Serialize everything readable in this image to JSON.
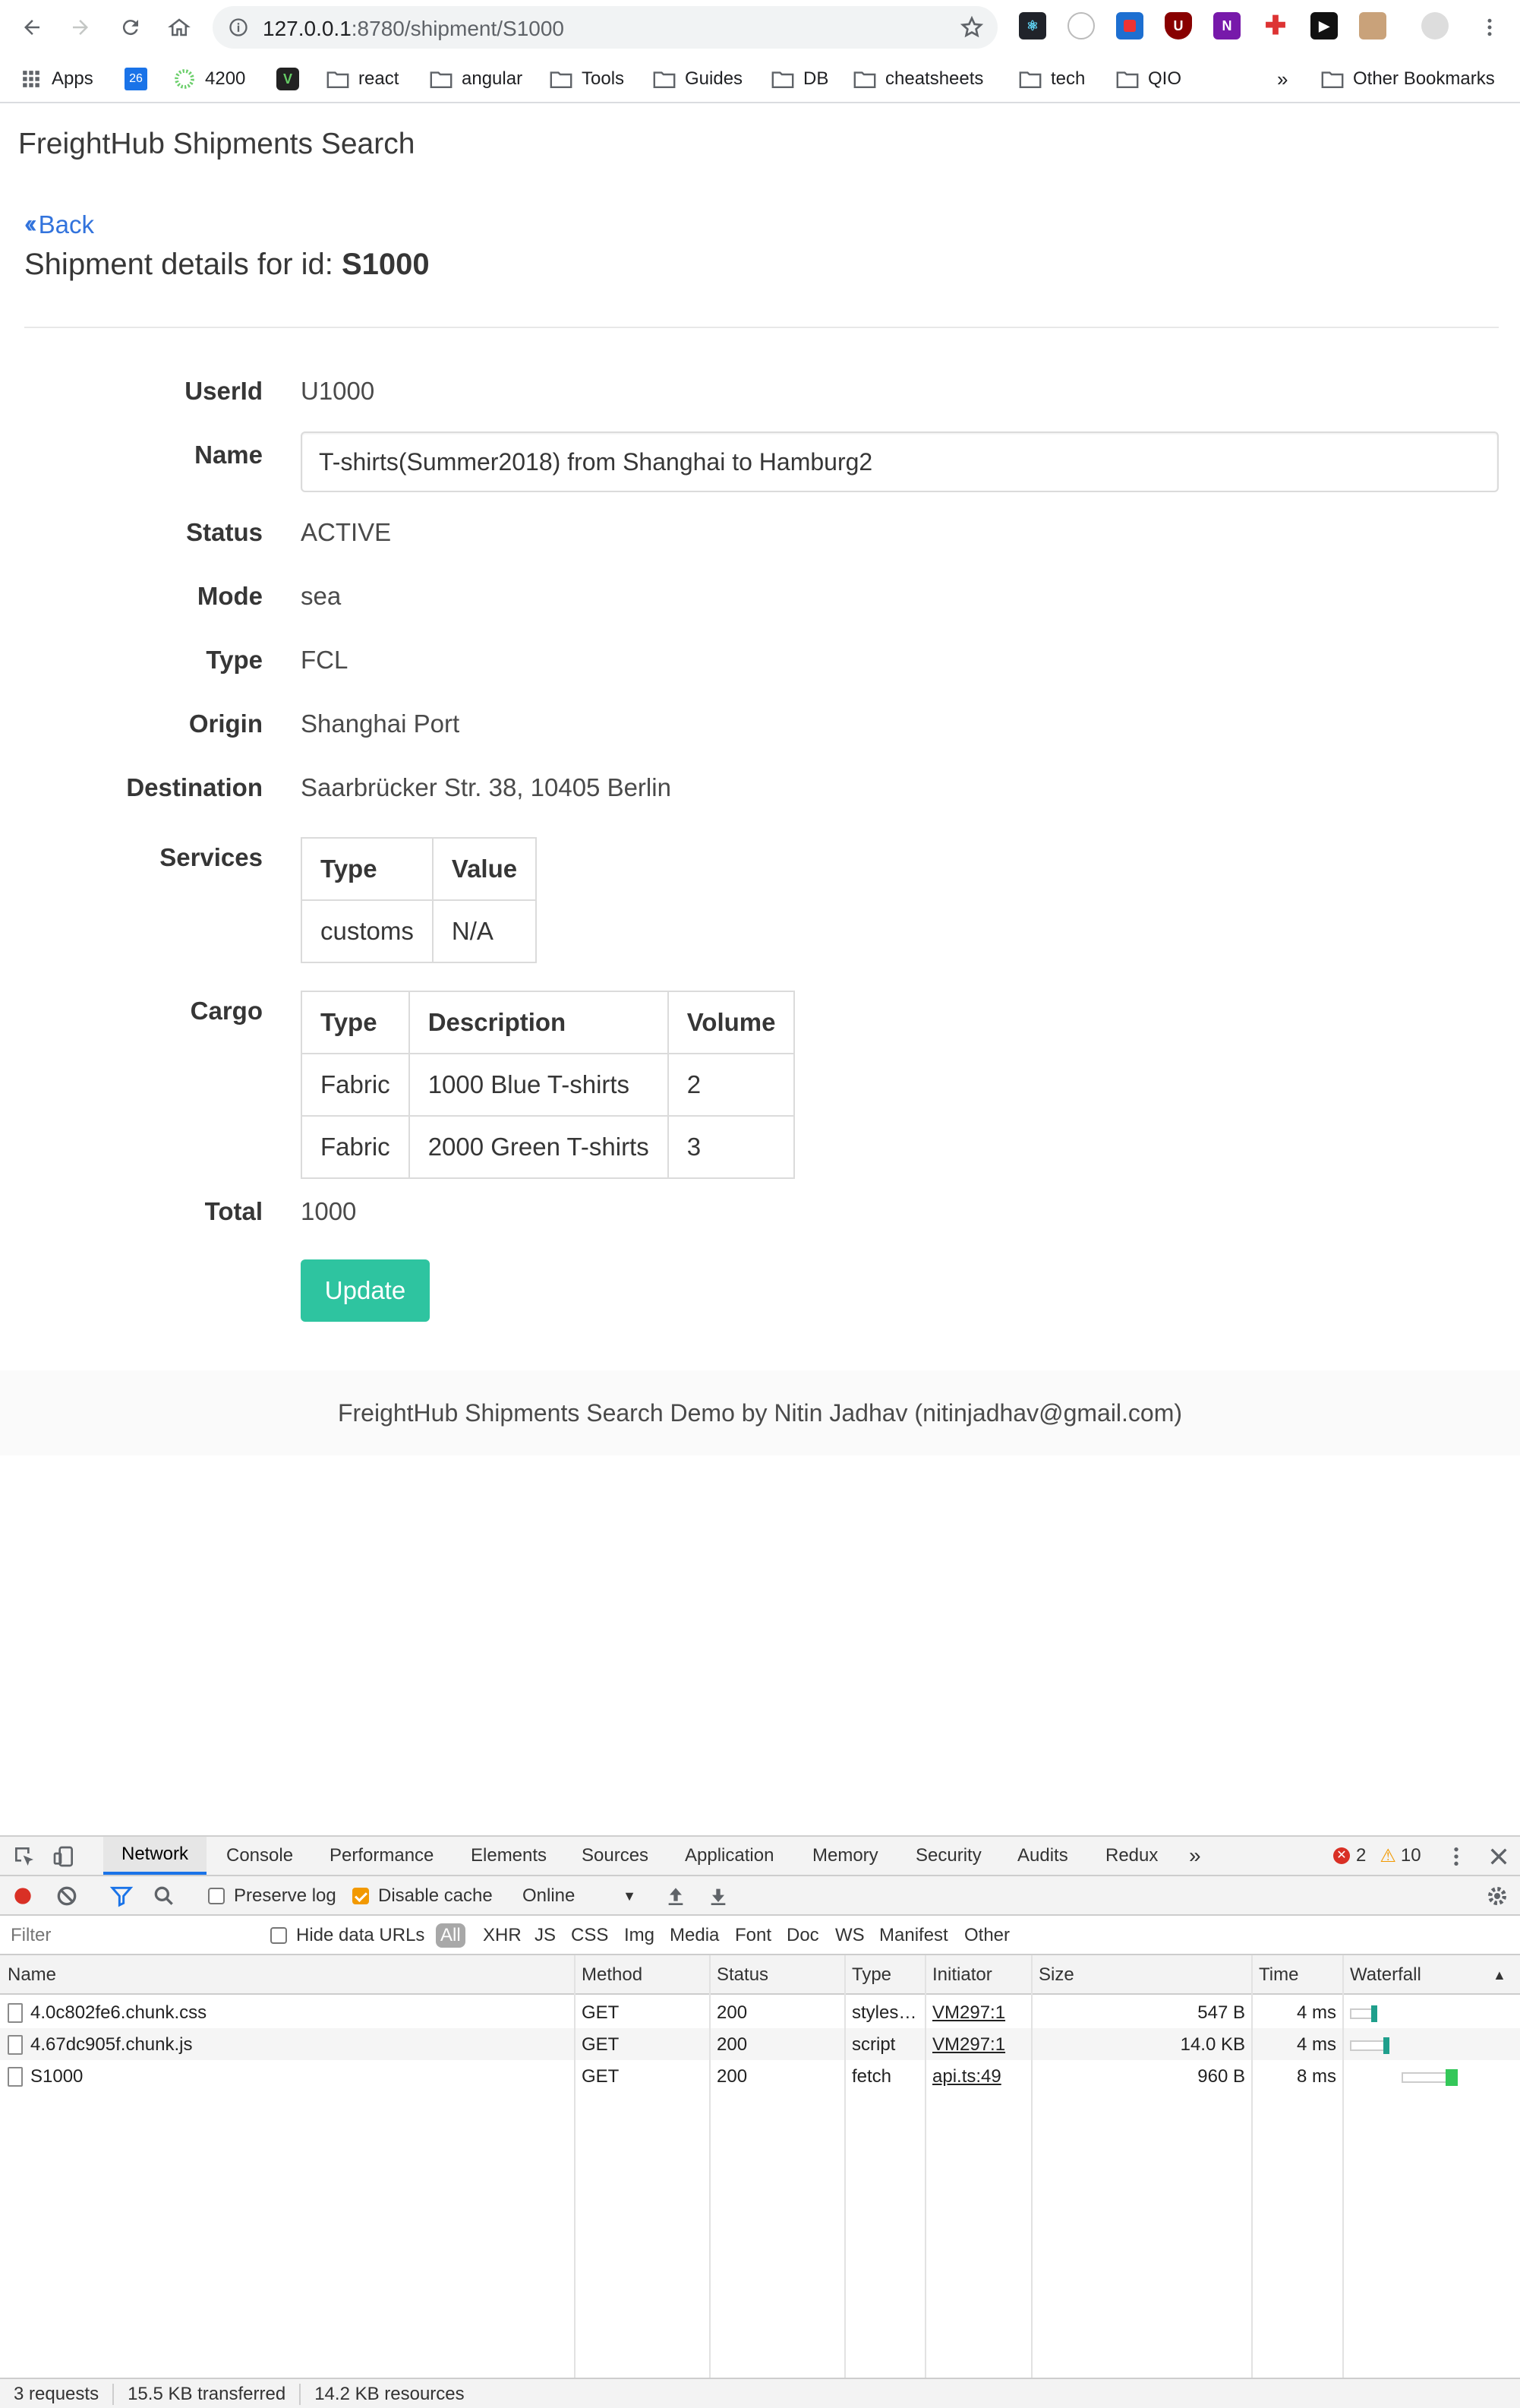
{
  "browser": {
    "url_host": "127.0.0.1",
    "url_path": ":8780/shipment/S1000",
    "bookmarks": [
      {
        "label": "Apps"
      },
      {
        "label": "26",
        "type": "calendar"
      },
      {
        "label": "4200"
      },
      {
        "label": "",
        "type": "extension"
      },
      {
        "label": "react"
      },
      {
        "label": "angular"
      },
      {
        "label": "Tools"
      },
      {
        "label": "Guides"
      },
      {
        "label": "DB"
      },
      {
        "label": "cheatsheets"
      },
      {
        "label": "tech"
      },
      {
        "label": "QIO"
      }
    ],
    "overflow": "»",
    "other_bookmarks": "Other Bookmarks",
    "extension_labels": {
      "ublock": "U",
      "onenote": "N"
    }
  },
  "app": {
    "brand": "FreightHub Shipments Search",
    "back_label": "Back",
    "heading_prefix": "Shipment details for id:",
    "shipment_id": "S1000"
  },
  "shipment": {
    "labels": {
      "userid": "UserId",
      "name": "Name",
      "status": "Status",
      "mode": "Mode",
      "type": "Type",
      "origin": "Origin",
      "destination": "Destination",
      "services": "Services",
      "cargo": "Cargo",
      "total": "Total"
    },
    "userid": "U1000",
    "name": "T-shirts(Summer2018) from Shanghai to Hamburg2",
    "status": "ACTIVE",
    "mode": "sea",
    "type": "FCL",
    "origin": "Shanghai Port",
    "destination": "Saarbrücker Str. 38, 10405 Berlin",
    "services": {
      "headers": [
        "Type",
        "Value"
      ],
      "rows": [
        [
          "customs",
          "N/A"
        ]
      ]
    },
    "cargo": {
      "headers": [
        "Type",
        "Description",
        "Volume"
      ],
      "rows": [
        [
          "Fabric",
          "1000 Blue T-shirts",
          "2"
        ],
        [
          "Fabric",
          "2000 Green T-shirts",
          "3"
        ]
      ]
    },
    "total": "1000",
    "update_label": "Update"
  },
  "footer": {
    "text": "FreightHub Shipments Search Demo by Nitin Jadhav (nitinjadhav@gmail.com)"
  },
  "devtools": {
    "tabs": [
      "Network",
      "Console",
      "Performance",
      "Elements",
      "Sources",
      "Application",
      "Memory",
      "Security",
      "Audits",
      "Redux"
    ],
    "more": "»",
    "errors": "2",
    "warnings": "10",
    "preserve_log": "Preserve log",
    "disable_cache": "Disable cache",
    "throttle": "Online",
    "filter_placeholder": "Filter",
    "hide_data_urls": "Hide data URLs",
    "type_filters": [
      "All",
      "XHR",
      "JS",
      "CSS",
      "Img",
      "Media",
      "Font",
      "Doc",
      "WS",
      "Manifest",
      "Other"
    ],
    "columns": [
      "Name",
      "Method",
      "Status",
      "Type",
      "Initiator",
      "Size",
      "Time",
      "Waterfall"
    ],
    "requests": [
      {
        "name": "4.0c802fe6.chunk.css",
        "method": "GET",
        "status": "200",
        "type": "styles…",
        "initiator": "VM297:1",
        "size": "547 B",
        "time": "4 ms"
      },
      {
        "name": "4.67dc905f.chunk.js",
        "method": "GET",
        "status": "200",
        "type": "script",
        "initiator": "VM297:1",
        "size": "14.0 KB",
        "time": "4 ms"
      },
      {
        "name": "S1000",
        "method": "GET",
        "status": "200",
        "type": "fetch",
        "initiator": "api.ts:49",
        "size": "960 B",
        "time": "8 ms"
      }
    ],
    "summary": {
      "requests": "3 requests",
      "transferred": "15.5 KB transferred",
      "resources": "14.2 KB resources"
    }
  }
}
